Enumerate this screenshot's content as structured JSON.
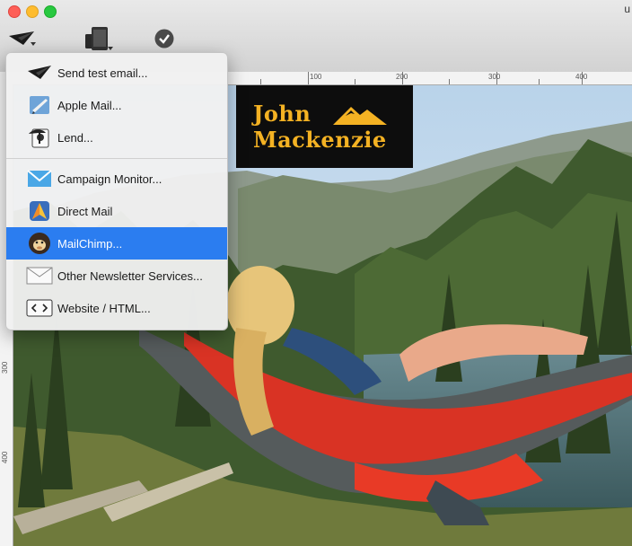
{
  "window": {
    "title_fragment": "u"
  },
  "toolbar": {
    "buttons": [
      {
        "name": "send",
        "icon": "paper-plane-icon"
      },
      {
        "name": "devices",
        "icon": "devices-icon"
      },
      {
        "name": "check",
        "icon": "checkmark-icon"
      }
    ]
  },
  "ruler": {
    "h_labels": [
      "100",
      "200",
      "300",
      "400"
    ],
    "v_labels": [
      "300",
      "400"
    ]
  },
  "canvas": {
    "logo_line1": "John",
    "logo_line2": "Mackenzie",
    "colors": {
      "logo_bg": "#0d0d0d",
      "logo_text": "#f4b223"
    }
  },
  "menu": {
    "items": [
      {
        "label": "Send test email...",
        "icon": "paper-plane-icon"
      },
      {
        "label": "Apple Mail...",
        "icon": "apple-mail-icon"
      },
      {
        "label": "Lend...",
        "icon": "lend-icon"
      },
      {
        "label": "Campaign Monitor...",
        "icon": "campaign-monitor-icon"
      },
      {
        "label": "Direct Mail",
        "icon": "direct-mail-icon"
      },
      {
        "label": "MailChimp...",
        "icon": "mailchimp-icon",
        "selected": true
      },
      {
        "label": "Other Newsletter Services...",
        "icon": "envelope-icon"
      },
      {
        "label": "Website / HTML...",
        "icon": "code-icon"
      }
    ],
    "colors": {
      "selection": "#2b7df0"
    }
  }
}
